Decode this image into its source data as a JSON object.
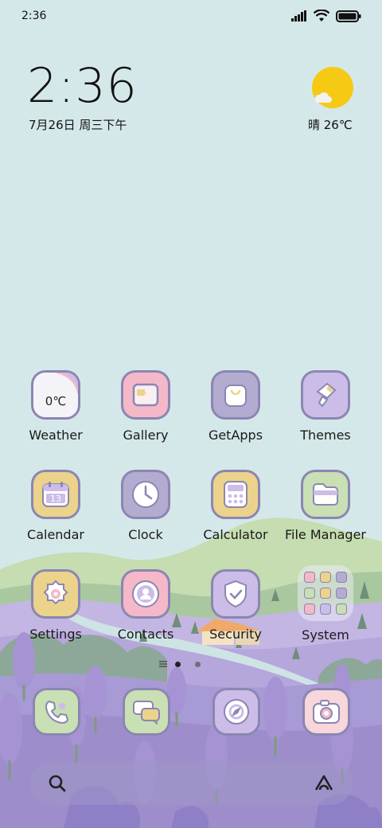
{
  "status_bar": {
    "time": "2:36"
  },
  "clock_widget": {
    "time": "2:36",
    "date": "7月26日 周三下午"
  },
  "weather_widget": {
    "condition_temp": "晴 26℃"
  },
  "apps": {
    "weather": {
      "label": "Weather",
      "temp": "0℃"
    },
    "gallery": {
      "label": "Gallery"
    },
    "getapps": {
      "label": "GetApps"
    },
    "themes": {
      "label": "Themes"
    },
    "calendar": {
      "label": "Calendar",
      "day": "13"
    },
    "clock": {
      "label": "Clock"
    },
    "calculator": {
      "label": "Calculator"
    },
    "file_manager": {
      "label": "File Manager"
    },
    "settings": {
      "label": "Settings"
    },
    "contacts": {
      "label": "Contacts"
    },
    "security": {
      "label": "Security"
    },
    "system": {
      "label": "System"
    }
  },
  "dock": {
    "apps": [
      "phone-icon",
      "messages-icon",
      "browser-icon",
      "camera-icon"
    ]
  },
  "search": {
    "icons": [
      "search-icon",
      "assistant-icon"
    ]
  },
  "colors": {
    "sky": "#d5e8e9",
    "icon_border": "#8b86b2",
    "yellow": "#ecd38b",
    "pink": "#f5b8c8",
    "lavender": "#cbbde8",
    "gray_purple": "#b3acd0",
    "green": "#c9dfb4",
    "lavender_field": "#b7a7d9"
  }
}
